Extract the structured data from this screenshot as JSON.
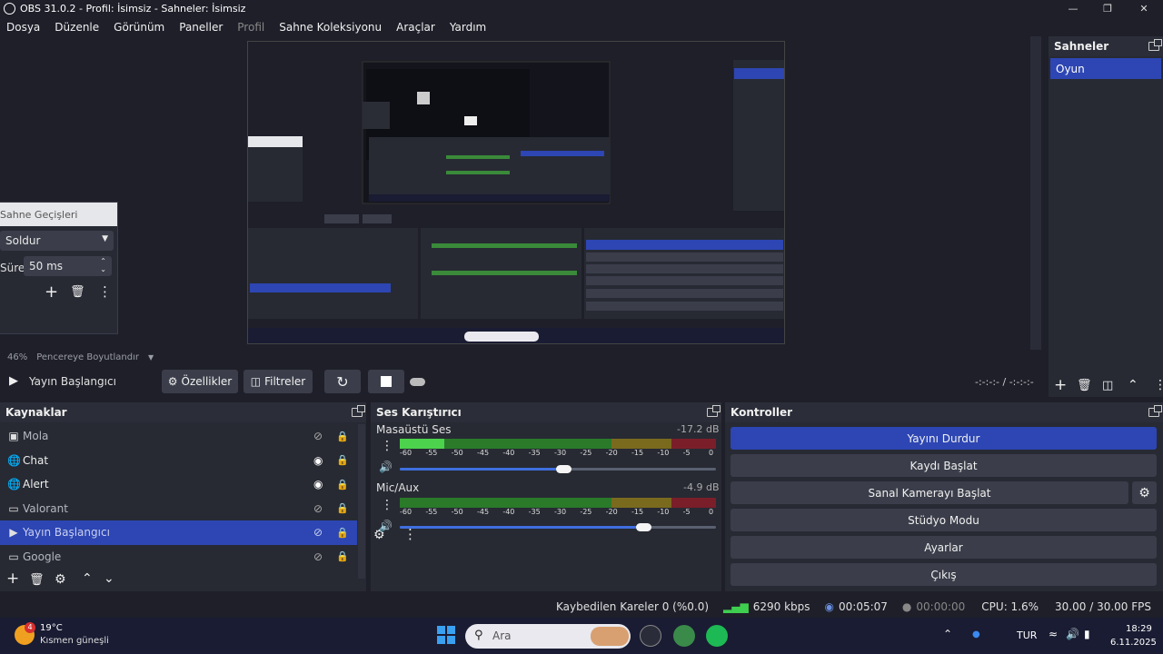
{
  "window": {
    "title": "OBS 31.0.2 - Profil: İsimsiz - Sahneler: İsimsiz"
  },
  "menu": [
    "Dosya",
    "Düzenle",
    "Görünüm",
    "Paneller",
    "Profil",
    "Sahne Koleksiyonu",
    "Araçlar",
    "Yardım"
  ],
  "transitions": {
    "title": "Sahne Geçişleri",
    "selected": "Soldur",
    "duration_label": "Süre",
    "duration_value": "50 ms"
  },
  "zoom": {
    "value": "46%",
    "mode": "Pencereye Boyutlandır"
  },
  "preview_bar": {
    "source_label": "Yayın Başlangıcı",
    "properties": "Özellikler",
    "filters": "Filtreler",
    "time": "-:-:-:- / -:-:-:-"
  },
  "scenes": {
    "title": "Sahneler",
    "items": [
      "Oyun"
    ]
  },
  "sources": {
    "title": "Kaynaklar",
    "items": [
      {
        "name": "Mola",
        "icon": "image-icon",
        "visible": false
      },
      {
        "name": "Chat",
        "icon": "globe-icon",
        "visible": true
      },
      {
        "name": "Alert",
        "icon": "globe-icon",
        "visible": true
      },
      {
        "name": "Valorant",
        "icon": "window-capture-icon",
        "visible": false
      },
      {
        "name": "Yayın Başlangıcı",
        "icon": "media-play-icon",
        "visible": false,
        "selected": true
      },
      {
        "name": "Google",
        "icon": "window-capture-icon",
        "visible": false
      }
    ]
  },
  "mixer": {
    "title": "Ses Karıştırıcı",
    "ticks": [
      "-60",
      "-55",
      "-50",
      "-45",
      "-40",
      "-35",
      "-30",
      "-25",
      "-20",
      "-15",
      "-10",
      "-5",
      "0"
    ],
    "channels": [
      {
        "name": "Masaüstü Ses",
        "db": "-17.2 dB",
        "level_fraction": 0.14,
        "volume_fraction": 0.53
      },
      {
        "name": "Mic/Aux",
        "db": "-4.9 dB",
        "level_fraction": 0.0,
        "volume_fraction": 0.77
      }
    ]
  },
  "controls": {
    "title": "Kontroller",
    "buttons": [
      "Yayını Durdur",
      "Kaydı Başlat",
      "Sanal Kamerayı Başlat",
      "Stüdyo Modu",
      "Ayarlar",
      "Çıkış"
    ]
  },
  "status": {
    "dropped": "Kaybedilen Kareler 0 (%0.0)",
    "bitrate": "6290 kbps",
    "stream_time": "00:05:07",
    "rec_time": "00:00:00",
    "cpu": "CPU: 1.6%",
    "fps": "30.00 / 30.00 FPS"
  },
  "taskbar": {
    "weather_temp": "19°C",
    "weather_desc": "Kısmen güneşli",
    "weather_badge": "4",
    "search": "Ara",
    "lang": "TUR",
    "time": "18:29",
    "date": "6.11.2025"
  },
  "colors": {
    "accent": "#2d46b3",
    "button": "#3b3e4a",
    "dock": "#272a33",
    "bg": "#1e1f29",
    "taskbar": "#1a1c33"
  }
}
